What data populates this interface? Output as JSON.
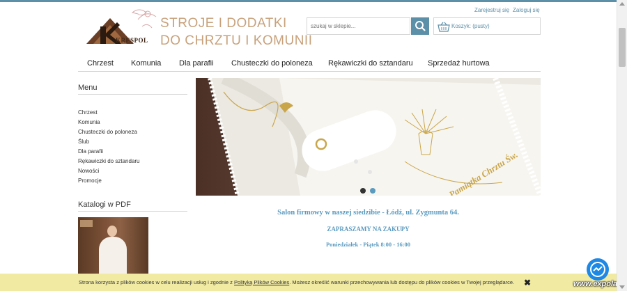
{
  "header": {
    "logo_title_line1": "STROJE I DODATKI",
    "logo_title_line2": "DO CHRZTU I KOMUNII",
    "logo_brand": "KRESPOL",
    "register_link": "Zarejestruj się",
    "login_link": "Zaloguj się",
    "search_placeholder": "szukaj w sklepie...",
    "cart_label": "Koszyk: (pusty)"
  },
  "nav": {
    "items": [
      "Chrzest",
      "Komunia",
      "Dla parafii",
      "Chusteczki do poloneza",
      "Rękawiczki do sztandaru",
      "Sprzedaż hurtowa"
    ]
  },
  "sidebar": {
    "menu_title": "Menu",
    "links": [
      "Chrzest",
      "Komunia",
      "Chusteczki do poloneza",
      "Ślub",
      "Dla parafii",
      "Rękawiczki do sztandaru",
      "Nowości",
      "Promocje"
    ],
    "catalog_title": "Katalogi w PDF"
  },
  "banner": {
    "embroidery_text": "Pamiątka Chrztu Św.",
    "active_slide": 1,
    "slide_count": 2
  },
  "content": {
    "line1": "Salon firmowy w naszej siedzibie - Łódź, ul. Zygmunta 64.",
    "line2": "ZAPRASZAMY NA ZAKUPY",
    "line3": "Poniedziałek - Piątek 8:00 - 16:00"
  },
  "cookie": {
    "text_before": "Strona korzysta z plików cookies w celu realizacji usług i zgodnie z ",
    "link": "Polityką Plików Cookies",
    "text_after": ". Możesz określić warunki przechowywania lub dostępu do plików cookies w Twojej przeglądarce.",
    "close": "✖"
  },
  "watermark": "www.expolab.pl",
  "colors": {
    "accent": "#5c8fa8",
    "gold": "#c8a27c",
    "cookie_bg": "#f1eaa2",
    "content_text": "#5a9bc0"
  }
}
